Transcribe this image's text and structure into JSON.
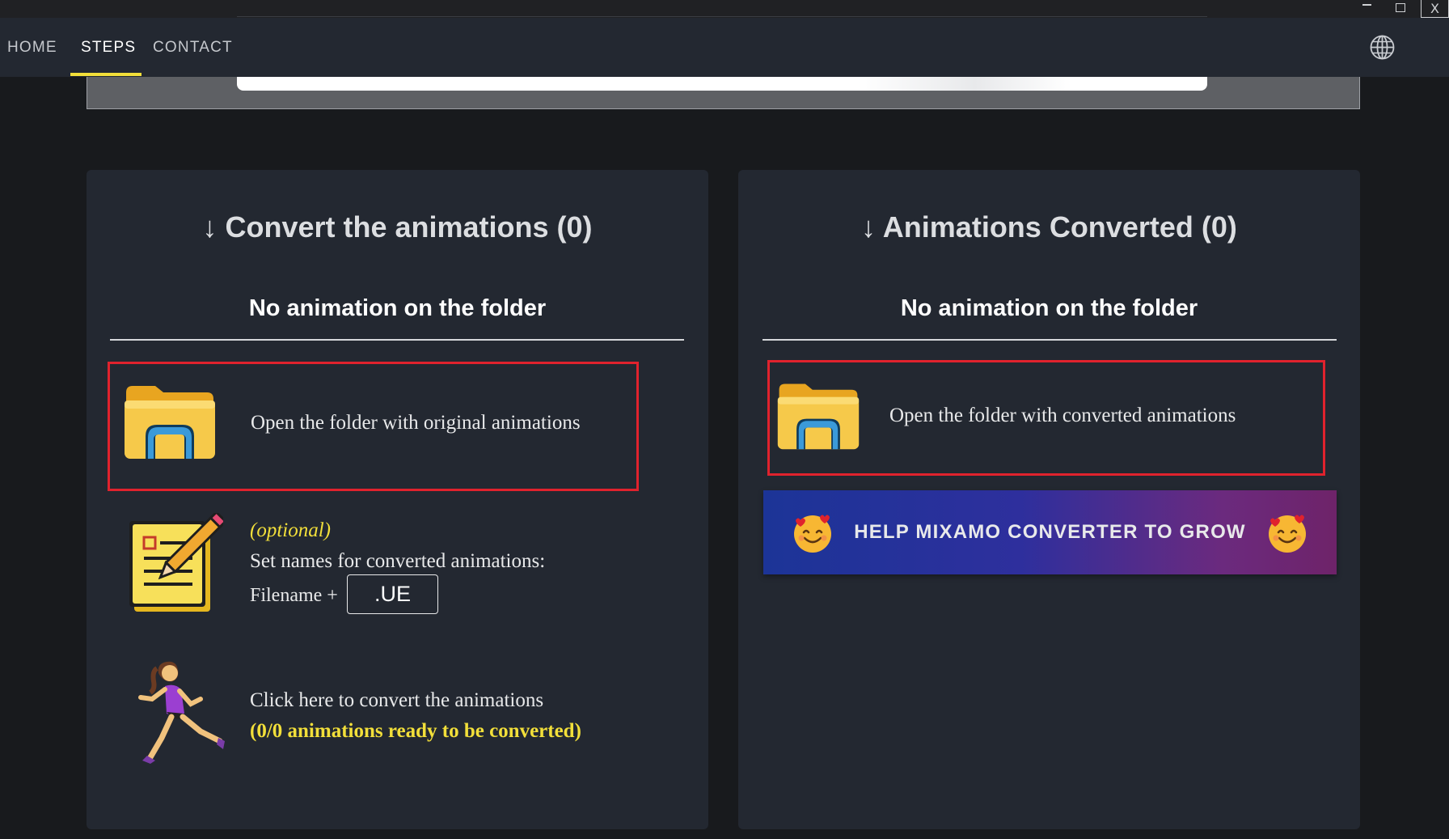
{
  "window": {
    "minimize_glyph": "",
    "close_glyph": "X"
  },
  "nav": {
    "items": [
      {
        "label": "HOME"
      },
      {
        "label": "STEPS",
        "active": true
      },
      {
        "label": "CONTACT"
      }
    ],
    "language_icon": "globe-icon",
    "accent_color": "#f2df3a"
  },
  "left_panel": {
    "title": "↓ Convert the animations (0)",
    "subtitle": "No animation on the folder",
    "open_folder": {
      "label": "Open the folder with original animations",
      "icon": "folder-icon"
    },
    "rename": {
      "optional_label": "(optional)",
      "description": "Set names for converted animations:",
      "filename_label": "Filename +",
      "suffix_value": ".UE",
      "icon": "notepad-pencil-icon"
    },
    "convert": {
      "label": "Click here to convert the animations",
      "status": "(0/0 animations ready to be converted)",
      "icon": "running-woman-icon"
    }
  },
  "right_panel": {
    "title": "↓ Animations Converted (0)",
    "subtitle": "No animation on the folder",
    "open_folder": {
      "label": "Open the folder with converted animations",
      "icon": "folder-icon"
    },
    "help_button": {
      "label": "HELP MIXAMO CONVERTER TO GROW",
      "icon": "smiling-face-with-hearts-icon"
    }
  },
  "colors": {
    "highlight_box": "#e0222d",
    "panel_bg": "#232831",
    "yellow": "#f2df3a"
  }
}
